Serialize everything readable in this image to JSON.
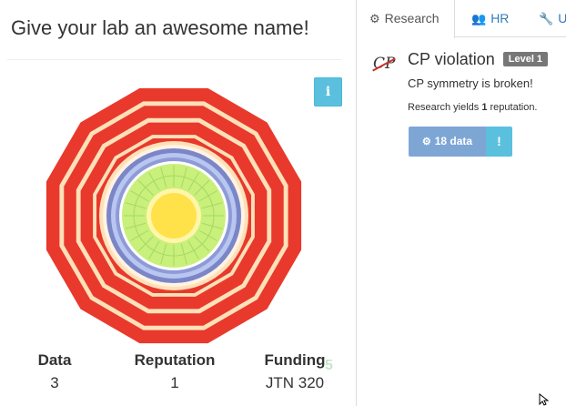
{
  "lab": {
    "title": "Give your lab an awesome name!",
    "info_icon": "i"
  },
  "stats": {
    "data_label": "Data",
    "data_value": "3",
    "reputation_label": "Reputation",
    "reputation_value": "1",
    "funding_label": "Funding",
    "funding_value": "JTN 320",
    "faded_overlay": "5"
  },
  "tabs": [
    {
      "label": "Research",
      "icon": "gears-icon",
      "active": true
    },
    {
      "label": "HR",
      "icon": "users-icon",
      "active": false
    },
    {
      "label": "Up",
      "icon": "wrench-icon",
      "active": false
    }
  ],
  "research": {
    "icon_text": "CP",
    "name": "CP violation",
    "level": "Level 1",
    "description": "CP symmetry is broken!",
    "yield_prefix": "Research yields ",
    "yield_amount": "1",
    "yield_suffix": " reputation.",
    "cost_button": "18 data",
    "info_button": "!"
  },
  "colors": {
    "detector_red": "#e8392c",
    "detector_cream": "#ffe0b8",
    "detector_blue": "#7b86c8",
    "detector_lightblue": "#b8c6f0",
    "detector_green": "#c8f07a",
    "detector_yellow": "#ffe14a",
    "button_primary": "#7ea6d5",
    "button_info": "#5bc0de",
    "badge_gray": "#777777",
    "link_blue": "#337ab7"
  }
}
